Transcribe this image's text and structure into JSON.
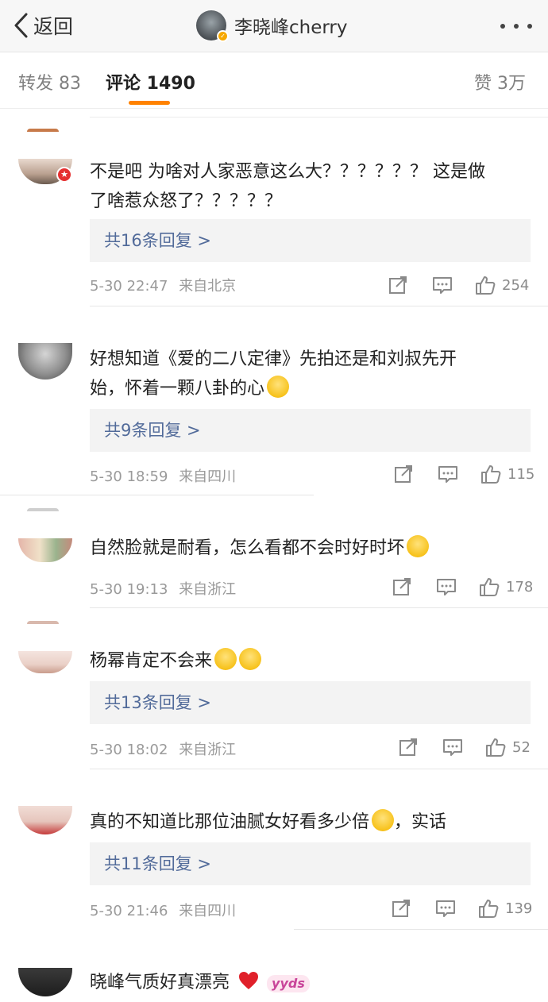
{
  "header": {
    "back_label": "返回",
    "title": "李晓峰cherry",
    "icons": [
      "chevron-left-icon",
      "verified-badge-icon",
      "more-icon"
    ]
  },
  "tabs": {
    "repost": "转发 83",
    "comments": "评论 1490",
    "likes": "赞 3万"
  },
  "colors": {
    "accent": "#ff8200",
    "link": "#526b9a",
    "muted": "#9a9a9a",
    "flag": "#e53030"
  },
  "comments": [
    {
      "text_line1": "不是吧 为啥对人家恶意这么大？？？？？？ 这是做",
      "text_line2": "了啥惹众怒了？？？？？",
      "replies": "共16条回复 >",
      "time": "5-30 22:47",
      "source": "来自北京",
      "likes": "254"
    },
    {
      "text_line1": "好想知道《爱的二八定律》先拍还是和刘叔先开",
      "text_line2": "始，怀着一颗八卦的心",
      "emoji": "hugging-face-emoji",
      "replies": "共9条回复 >",
      "time": "5-30 18:59",
      "source": "来自四川",
      "likes": "115"
    },
    {
      "text_line1": "自然脸就是耐看，怎么看都不会时好时坏",
      "emoji": "laughing-tears-emoji",
      "time": "5-30 19:13",
      "source": "来自浙江",
      "likes": "178"
    },
    {
      "text_line1": "杨幂肯定不会来",
      "emoji": "rolling-eyes-emoji",
      "replies": "共13条回复 >",
      "time": "5-30 18:02",
      "source": "来自浙江",
      "likes": "52"
    },
    {
      "text_line1": "真的不知道比那位油腻女好看多少倍",
      "text_after_emoji": "，实话",
      "emoji": "heart-eyes-emoji",
      "replies": "共11条回复 >",
      "time": "5-30 21:46",
      "source": "来自四川",
      "likes": "139"
    },
    {
      "text_line1": "晓峰气质好真漂亮",
      "emoji": "red-heart-emoji",
      "sticker_text": "yyds"
    }
  ]
}
